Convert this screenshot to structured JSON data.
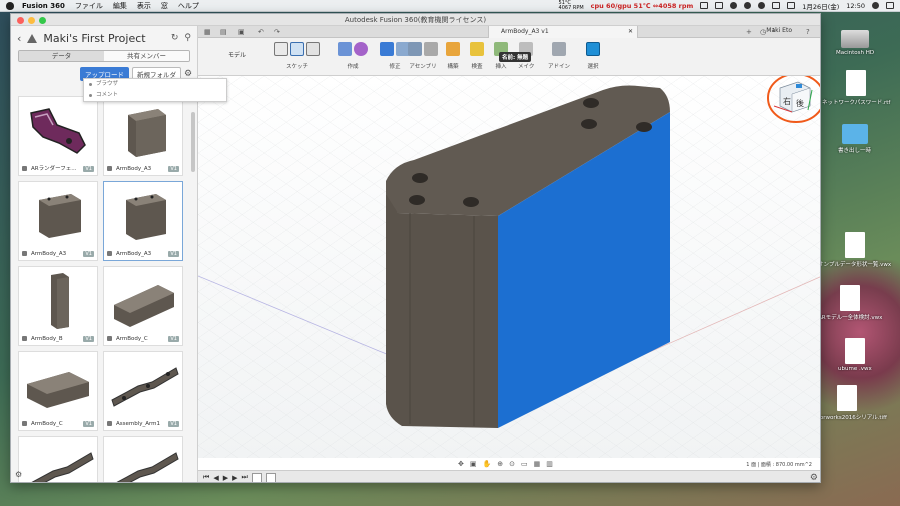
{
  "menubar": {
    "app": "Fusion 360",
    "menus": [
      "ファイル",
      "編集",
      "表示",
      "窓",
      "ヘルプ"
    ],
    "temp": "51°C",
    "rpm": "4067 RPM",
    "cpu": "cpu 60/gpu 51℃ ⇔4058 rpm",
    "date": "1月26日(金)",
    "time": "12:50"
  },
  "window": {
    "title": "Autodesk Fusion 360(教育機関ライセンス)"
  },
  "panel": {
    "title": "Maki's First Project",
    "tabs": [
      "データ",
      "共有メンバー"
    ],
    "upload": "アップロード",
    "new_folder": "新規フォルダ",
    "dropdown": [
      "ブラウザ",
      "コメント"
    ],
    "items": [
      {
        "label": "ARランダーフェ...",
        "version": "V1"
      },
      {
        "label": "ArmBody_A3",
        "version": "V1"
      },
      {
        "label": "ArmBody_A3",
        "version": "V1"
      },
      {
        "label": "ArmBody_A3",
        "version": "V1"
      },
      {
        "label": "ArmBody_B",
        "version": "V1"
      },
      {
        "label": "ArmBody_C",
        "version": "V1"
      },
      {
        "label": "ArmBody_C",
        "version": "V1"
      },
      {
        "label": "Assembly_Arm1",
        "version": "V1"
      }
    ]
  },
  "tab": {
    "label": "ArmBody_A3 v1",
    "user": "Maki Eto",
    "count": "1"
  },
  "toolbar": {
    "mode": "モデル",
    "groups": [
      "スケッチ",
      "作成",
      "修正",
      "アセンブリ",
      "構築",
      "検査",
      "挿入",
      "メイク",
      "アドイン",
      "選択"
    ],
    "tooltip": "名前: 無題"
  },
  "viewcube": {
    "face1": "右",
    "face2": "後"
  },
  "status": {
    "measure": "1 面 | 面積 : 870.00 mm^2"
  },
  "desktop": {
    "items": [
      "Macintosh HD",
      "ネットワークパスワード.rtf",
      "書き出し一時",
      "サンプルデータ形状一覧.vwx",
      "ARモデル一全体検討.vwx",
      "ubume .vwx",
      "Vectorworks2016シリアル.tiff"
    ]
  },
  "colors": {
    "selected_face": "#1c6fd1",
    "body": "#5e574f",
    "accent": "#3a7bd5",
    "highlight_circle": "#f05a1a"
  }
}
